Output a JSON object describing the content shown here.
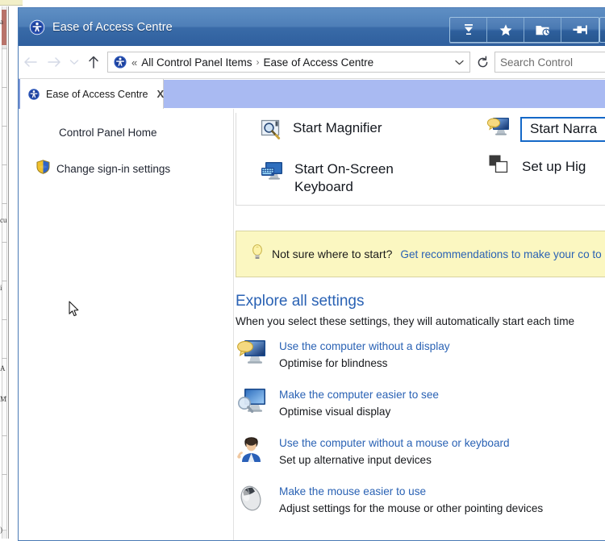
{
  "window": {
    "title": "Ease of Access Centre",
    "app_icon": "ease-of-access-icon"
  },
  "toolbar": {
    "buttons": [
      {
        "name": "downloads-icon",
        "label": "Downloads"
      },
      {
        "name": "favourites-star-icon",
        "label": "Favourites"
      },
      {
        "name": "history-folder-clock-icon",
        "label": "History"
      },
      {
        "name": "pin-icon",
        "label": "Pin"
      }
    ]
  },
  "navigation": {
    "back_label": "Back",
    "forward_label": "Forward",
    "recent_label": "Recent locations",
    "up_label": "Up"
  },
  "address": {
    "icon": "ease-of-access-icon",
    "overflow": "«",
    "crumbs": [
      "All Control Panel Items",
      "Ease of Access Centre"
    ],
    "separator": "›",
    "dropdown_label": "Previous locations",
    "refresh_label": "Refresh"
  },
  "search": {
    "placeholder": "Search Control"
  },
  "tab": {
    "label": "Ease of Access Centre",
    "close_label": "X",
    "icon": "ease-of-access-icon"
  },
  "sidebar": {
    "home_label": "Control Panel Home",
    "signin_label": "Change sign-in settings",
    "signin_icon": "shield-icon"
  },
  "quick_actions": {
    "left": [
      {
        "icon": "magnifier-icon",
        "label": "Start Magnifier"
      },
      {
        "icon": "onscreen-keyboard-icon",
        "label": "Start On-Screen\nKeyboard"
      }
    ],
    "right": [
      {
        "icon": "narrator-monitor-icon",
        "label": "Start Narra",
        "focused": true
      },
      {
        "icon": "high-contrast-icon",
        "label": "Set up Hig",
        "focused": false
      }
    ]
  },
  "recommendation": {
    "icon": "lightbulb-icon",
    "question": "Not sure where to start?",
    "link": "Get recommendations to make your co to use"
  },
  "explore": {
    "title": "Explore all settings",
    "subtitle": "When you select these settings, they will automatically start each time",
    "items": [
      {
        "icon": "monitor-no-display-icon",
        "link": "Use the computer without a display",
        "desc": "Optimise for blindness"
      },
      {
        "icon": "monitor-magnifier-icon",
        "link": "Make the computer easier to see",
        "desc": "Optimise visual display"
      },
      {
        "icon": "person-icon",
        "link": "Use the computer without a mouse or keyboard",
        "desc": "Set up alternative input devices"
      },
      {
        "icon": "mouse-icon",
        "link": "Make the mouse easier to use",
        "desc": "Adjust settings for the mouse or other pointing devices"
      }
    ]
  },
  "colors": {
    "titlebar_top": "#5f8fc4",
    "titlebar_bottom": "#2f5f9e",
    "tab_band": "#a9baf2",
    "link": "#2a62b4",
    "focus_outline": "#1468c8",
    "notice_bg": "#fbf7c1",
    "notice_border": "#d8d3a0"
  }
}
